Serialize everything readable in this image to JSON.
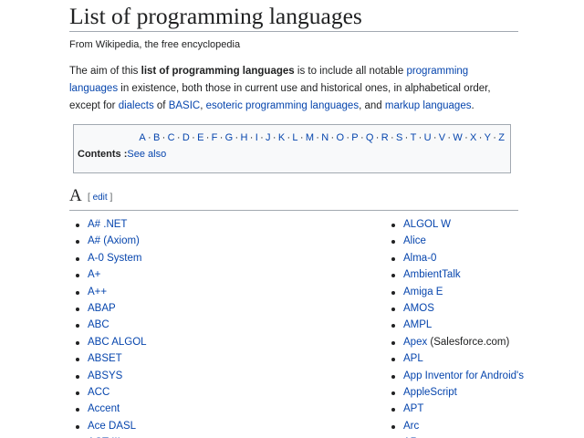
{
  "page": {
    "title": "List of programming languages",
    "tagline": "From Wikipedia, the free encyclopedia"
  },
  "intro": {
    "t1": "The aim of this ",
    "b1": "list of programming languages",
    "t2": " is to include all notable ",
    "l1": "programming languages",
    "t3": " in existence, both those in current use and historical ones, in alphabetical order, except for ",
    "l2": "dialects",
    "t4": " of ",
    "l3": "BASIC",
    "t5": ", ",
    "l4": "esoteric programming languages",
    "t6": ", and ",
    "l5": "markup languages",
    "t7": "."
  },
  "toc": {
    "letters": [
      "A",
      "B",
      "C",
      "D",
      "E",
      "F",
      "G",
      "H",
      "I",
      "J",
      "K",
      "L",
      "M",
      "N",
      "O",
      "P",
      "Q",
      "R",
      "S",
      "T",
      "U",
      "V",
      "W",
      "X",
      "Y",
      "Z"
    ],
    "separator": "·",
    "contents_label": "Contents :",
    "see_also": "See also"
  },
  "section": {
    "letter": "A",
    "edit_open": "[ ",
    "edit_label": "edit",
    "edit_close": " ]"
  },
  "left_items": [
    {
      "label": "A# .NET"
    },
    {
      "label": "A# (Axiom)"
    },
    {
      "label": "A-0 System"
    },
    {
      "label": "A+"
    },
    {
      "label": "A++"
    },
    {
      "label": "ABAP"
    },
    {
      "label": "ABC"
    },
    {
      "label": "ABC ALGOL"
    },
    {
      "label": "ABSET"
    },
    {
      "label": "ABSYS"
    },
    {
      "label": "ACC"
    },
    {
      "label": "Accent"
    },
    {
      "label": "Ace DASL"
    },
    {
      "label": "ACT-III"
    }
  ],
  "right_items": [
    {
      "label": "ALGOL W",
      "suffix": ""
    },
    {
      "label": "Alice",
      "suffix": ""
    },
    {
      "label": "Alma-0",
      "suffix": ""
    },
    {
      "label": "AmbientTalk",
      "suffix": ""
    },
    {
      "label": "Amiga E",
      "suffix": ""
    },
    {
      "label": "AMOS",
      "suffix": ""
    },
    {
      "label": "AMPL",
      "suffix": ""
    },
    {
      "label": "Apex",
      "suffix": " (Salesforce.com)"
    },
    {
      "label": "APL",
      "suffix": ""
    },
    {
      "label": "App Inventor for Android's",
      "suffix": ""
    },
    {
      "label": "AppleScript",
      "suffix": ""
    },
    {
      "label": "APT",
      "suffix": ""
    },
    {
      "label": "Arc",
      "suffix": ""
    },
    {
      "label": "ARexx",
      "suffix": ""
    }
  ],
  "colors": {
    "link": "#0645ad",
    "text": "#202122",
    "border": "#a2a9b1",
    "toc_bg": "#f8f9fa"
  }
}
